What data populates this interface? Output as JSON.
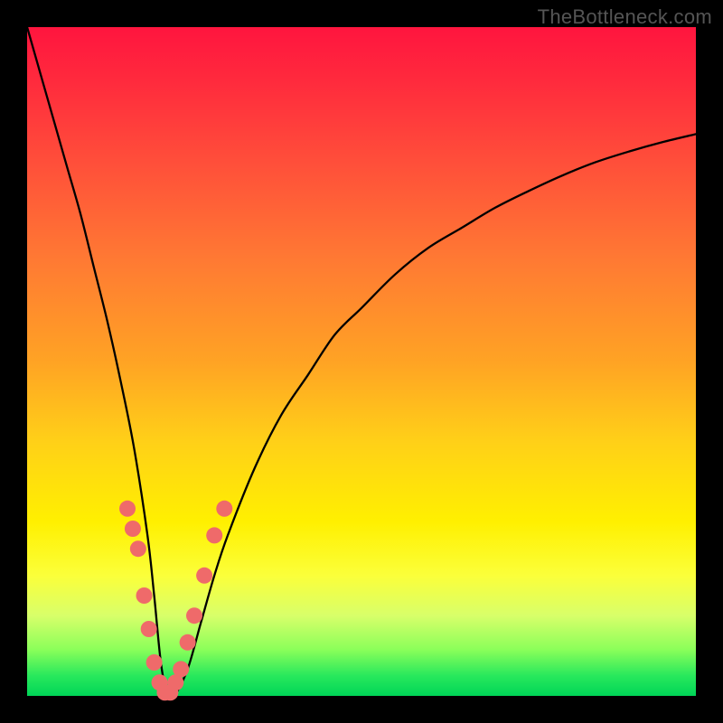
{
  "watermark": "TheBottleneck.com",
  "chart_data": {
    "type": "line",
    "title": "",
    "xlabel": "",
    "ylabel": "",
    "xlim": [
      0,
      100
    ],
    "ylim": [
      0,
      100
    ],
    "series": [
      {
        "name": "curve",
        "x": [
          0,
          2,
          4,
          6,
          8,
          10,
          12,
          14,
          16,
          18,
          19,
          20,
          21,
          22,
          24,
          26,
          28,
          30,
          34,
          38,
          42,
          46,
          50,
          55,
          60,
          65,
          70,
          75,
          80,
          85,
          90,
          95,
          100
        ],
        "y": [
          100,
          93,
          86,
          79,
          72,
          64,
          56,
          47,
          37,
          24,
          15,
          5,
          0,
          0,
          4,
          11,
          18,
          24,
          34,
          42,
          48,
          54,
          58,
          63,
          67,
          70,
          73,
          75.5,
          77.8,
          79.8,
          81.4,
          82.8,
          84
        ]
      }
    ],
    "markers": {
      "name": "highlight-dots",
      "color": "#ef6a6a",
      "points": [
        {
          "x": 15.0,
          "y": 28
        },
        {
          "x": 15.8,
          "y": 25
        },
        {
          "x": 16.6,
          "y": 22
        },
        {
          "x": 17.5,
          "y": 15
        },
        {
          "x": 18.2,
          "y": 10
        },
        {
          "x": 19.0,
          "y": 5
        },
        {
          "x": 19.8,
          "y": 2
        },
        {
          "x": 20.6,
          "y": 0.5
        },
        {
          "x": 21.4,
          "y": 0.5
        },
        {
          "x": 22.2,
          "y": 2
        },
        {
          "x": 23.0,
          "y": 4
        },
        {
          "x": 24.0,
          "y": 8
        },
        {
          "x": 25.0,
          "y": 12
        },
        {
          "x": 26.5,
          "y": 18
        },
        {
          "x": 28.0,
          "y": 24
        },
        {
          "x": 29.5,
          "y": 28
        }
      ]
    }
  }
}
